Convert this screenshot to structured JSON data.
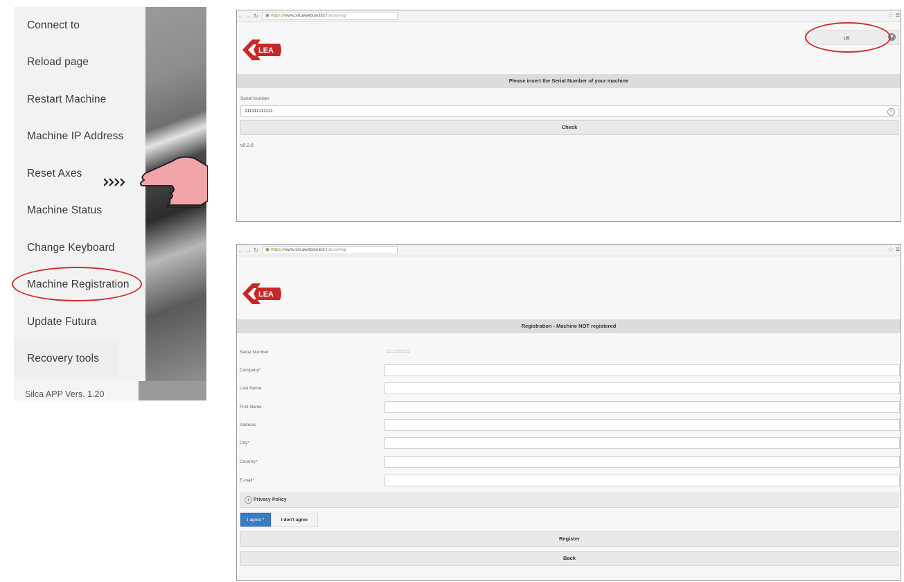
{
  "left_menu": {
    "items": [
      {
        "label": "Connect to"
      },
      {
        "label": "Reload page"
      },
      {
        "label": "Restart Machine"
      },
      {
        "label": "Machine IP Address"
      },
      {
        "label": "Reset Axes"
      },
      {
        "label": "Machine Status"
      },
      {
        "label": "Change Keyboard"
      },
      {
        "label": "Machine Registration"
      },
      {
        "label": "Update Futura"
      },
      {
        "label": "Recovery tools"
      }
    ],
    "version": "Silca APP Vers. 1.20",
    "highlight_color": "#d32f2f"
  },
  "browser_top": {
    "url_secure": "https://",
    "url_host": "www.silcawebow.biz",
    "url_path": "/futura/reg/",
    "language": "us",
    "section_title": "Please insert the Serial Number of your machine",
    "serial_label": "Serial Number",
    "serial_value": "111111111111",
    "check_button": "Check",
    "version": "v0.2.6"
  },
  "browser_bottom": {
    "url_secure": "https://",
    "url_host": "www.silcawebow.biz",
    "url_path": "/futura/reg/",
    "section_title": "Registration - Machine NOT registered",
    "fields": [
      {
        "label": "Serial Number",
        "value": "111111111111"
      },
      {
        "label": "Company*",
        "value": ""
      },
      {
        "label": "Last Name",
        "value": ""
      },
      {
        "label": "First Name",
        "value": ""
      },
      {
        "label": "Address",
        "value": ""
      },
      {
        "label": "City*",
        "value": ""
      },
      {
        "label": "Country*",
        "value": ""
      },
      {
        "label": "E-mail*",
        "value": ""
      }
    ],
    "privacy_label": "Privacy Policy",
    "agree_label": "I agree *",
    "disagree_label": "I don't agree",
    "register_button": "Register",
    "back_button": "Back",
    "accent_color": "#3b7bbf"
  },
  "brand": {
    "logo_text": "SILCA",
    "logo_color": "#c62828"
  }
}
